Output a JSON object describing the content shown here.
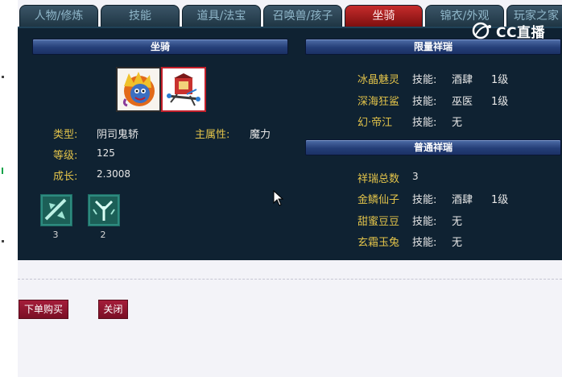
{
  "tabs": [
    {
      "label": "人物/修炼",
      "active": false
    },
    {
      "label": "技能",
      "active": false
    },
    {
      "label": "道具/法宝",
      "active": false
    },
    {
      "label": "召唤兽/孩子",
      "active": false
    },
    {
      "label": "坐骑",
      "active": true
    },
    {
      "label": "锦衣/外观",
      "active": false
    },
    {
      "label": "玩家之家",
      "active": false
    }
  ],
  "mount": {
    "header": "坐骑",
    "type_label": "类型:",
    "type_value": "阴司鬼轿",
    "attr_label": "主属性:",
    "attr_value": "魔力",
    "level_label": "等级:",
    "level_value": "125",
    "growth_label": "成长:",
    "growth_value": "2.3008",
    "icons": [
      "lion-mount-icon",
      "palanquin-mount-icon"
    ],
    "skills": [
      {
        "icon": "sword-skill-icon",
        "level": "3"
      },
      {
        "icon": "claw-skill-icon",
        "level": "2"
      }
    ]
  },
  "limited": {
    "header": "限量祥瑞",
    "items": [
      {
        "name": "冰晶魅灵",
        "skill_label": "技能:",
        "skill": "酒肆",
        "level": "1级"
      },
      {
        "name": "深海狂鲨",
        "skill_label": "技能:",
        "skill": "巫医",
        "level": "1级"
      },
      {
        "name": "幻·帝江",
        "skill_label": "技能:",
        "skill": "无",
        "level": ""
      }
    ]
  },
  "normal": {
    "header": "普通祥瑞",
    "total_label": "祥瑞总数",
    "total_value": "3",
    "items": [
      {
        "name": "金鳞仙子",
        "skill_label": "技能:",
        "skill": "酒肆",
        "level": "1级"
      },
      {
        "name": "甜蜜豆豆",
        "skill_label": "技能:",
        "skill": "无",
        "level": ""
      },
      {
        "name": "玄霜玉兔",
        "skill_label": "技能:",
        "skill": "无",
        "level": ""
      }
    ]
  },
  "actions": {
    "buy_label": "下单购买",
    "close_label": "关闭"
  },
  "watermark": {
    "text": "CC直播"
  },
  "colors": {
    "panel_bg": "#0f2232",
    "label_gold": "#e2c34a",
    "value_text": "#e7e7e7",
    "active_tab": "#b31f1f",
    "button_bg": "#95173a"
  }
}
